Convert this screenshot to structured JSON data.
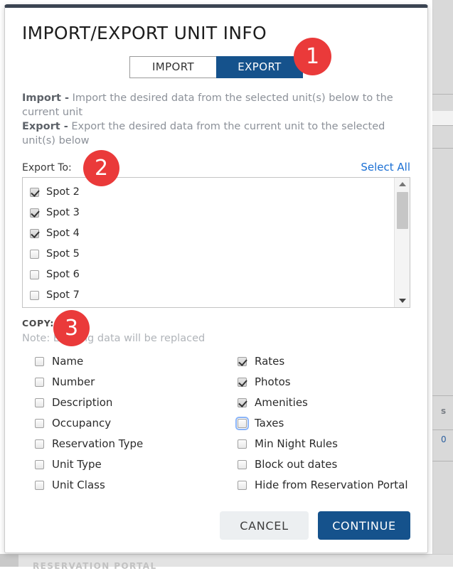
{
  "modal": {
    "title": "IMPORT/EXPORT UNIT INFO",
    "tabs": [
      {
        "label": "IMPORT",
        "active": false
      },
      {
        "label": "EXPORT",
        "active": true
      }
    ],
    "description": {
      "import_term": "Import -",
      "import_text": " Import the desired data from the selected unit(s) below to the current unit",
      "export_term": "Export -",
      "export_text": " Export the desired data from the current unit to the selected unit(s) below"
    },
    "export_to": {
      "label": "Export To:",
      "select_all": "Select All",
      "items": [
        {
          "label": "Spot 2",
          "checked": true
        },
        {
          "label": "Spot 3",
          "checked": true
        },
        {
          "label": "Spot 4",
          "checked": true
        },
        {
          "label": "Spot 5",
          "checked": false
        },
        {
          "label": "Spot 6",
          "checked": false
        },
        {
          "label": "Spot 7",
          "checked": false
        }
      ],
      "scrollbar": {
        "up_icon": "triangle-up-icon",
        "down_icon": "triangle-down-icon"
      }
    },
    "copy": {
      "label": "COPY:",
      "note": "Note: Existing data will be replaced",
      "left_column": [
        {
          "label": "Name",
          "checked": false,
          "focused": false
        },
        {
          "label": "Number",
          "checked": false,
          "focused": false
        },
        {
          "label": "Description",
          "checked": false,
          "focused": false
        },
        {
          "label": "Occupancy",
          "checked": false,
          "focused": false
        },
        {
          "label": "Reservation Type",
          "checked": false,
          "focused": false
        },
        {
          "label": "Unit Type",
          "checked": false,
          "focused": false
        },
        {
          "label": "Unit Class",
          "checked": false,
          "focused": false
        }
      ],
      "right_column": [
        {
          "label": "Rates",
          "checked": true,
          "focused": false
        },
        {
          "label": "Photos",
          "checked": true,
          "focused": false
        },
        {
          "label": "Amenities",
          "checked": true,
          "focused": false
        },
        {
          "label": "Taxes",
          "checked": false,
          "focused": true
        },
        {
          "label": "Min Night Rules",
          "checked": false,
          "focused": false
        },
        {
          "label": "Block out dates",
          "checked": false,
          "focused": false
        },
        {
          "label": "Hide from Reservation Portal",
          "checked": false,
          "focused": false
        }
      ]
    },
    "footer": {
      "cancel": "CANCEL",
      "continue": "CONTINUE"
    }
  },
  "step_badges": [
    {
      "number": "1"
    },
    {
      "number": "2"
    },
    {
      "number": "3"
    }
  ],
  "background": {
    "fragment_s": "s",
    "fragment_0": "0",
    "bottom_text": "RESERVATION PORTAL"
  },
  "colors": {
    "accent_blue": "#15528c",
    "link_blue": "#1a6fd4",
    "badge_red": "#ea3a3a",
    "modal_top_border": "#3b4452",
    "muted_text": "#8c9199"
  }
}
